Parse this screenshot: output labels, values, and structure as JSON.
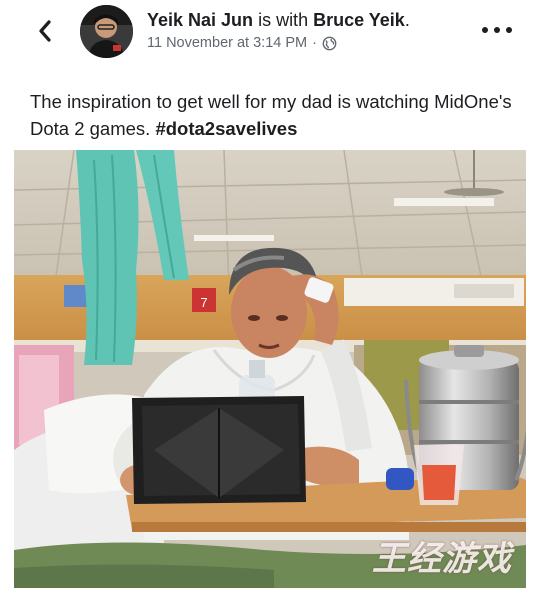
{
  "header": {
    "author_name": "Yeik Nai Jun",
    "with_text": " is with ",
    "tagged_name": "Bruce Yeik",
    "tagged_suffix": ".",
    "timestamp": "11 November at 3:14 PM",
    "separator": "·",
    "privacy_icon": "globe-icon",
    "back_icon": "chevron-left-icon",
    "more_icon": "more-horizontal-icon"
  },
  "post": {
    "text": "The inspiration to get well for my dad is watching MidOne's Dota 2 games. ",
    "hashtag": "#dota2savelives"
  },
  "photo": {
    "wall_sign": "7",
    "watermark": "王经游戏"
  },
  "colors": {
    "text": "#1c1e21",
    "meta": "#606770",
    "curtain": "#5fc4b4"
  }
}
